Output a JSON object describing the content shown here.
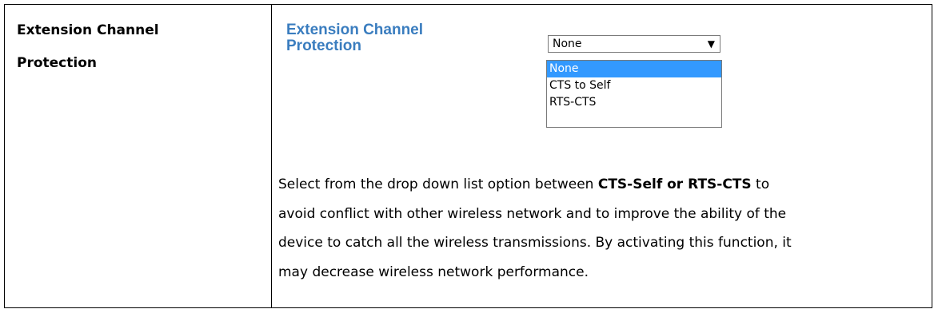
{
  "term": {
    "line1": "Extension Channel",
    "line2": "Protection"
  },
  "setting": {
    "label_line1": "Extension Channel",
    "label_line2": "Protection",
    "select_value": "None",
    "arrow_icon": "▼",
    "options": [
      "None",
      "CTS to Self",
      "RTS-CTS"
    ],
    "selected_option": "None"
  },
  "description": {
    "line1_before": "Select from the drop down list option between ",
    "line1_bold": "CTS-Self or RTS-CTS",
    "line1_after": " to",
    "line2": "avoid conflict with other wireless network and to improve the ability of the",
    "line3": "device to catch all the wireless transmissions. By activating this function, it",
    "line4": "may decrease wireless network performance."
  }
}
